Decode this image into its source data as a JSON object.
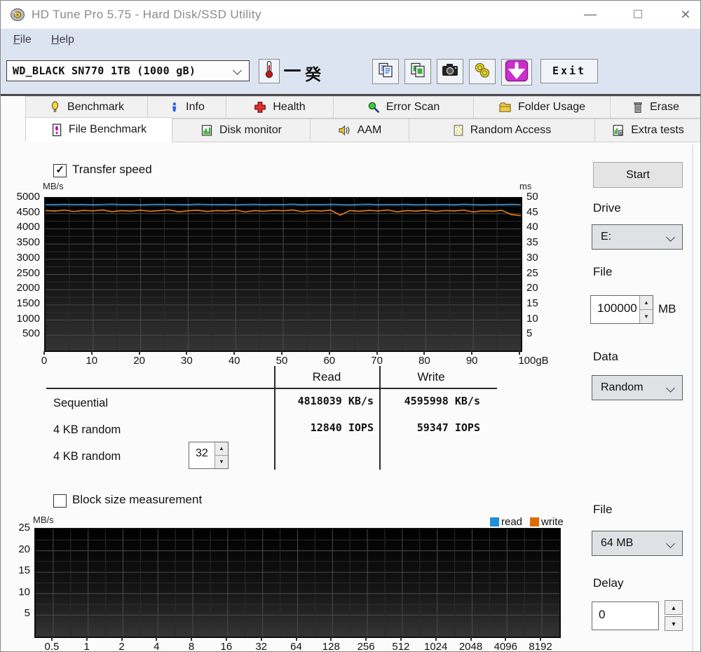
{
  "window": {
    "title": "HD Tune Pro 5.75 - Hard Disk/SSD Utility",
    "minimize": "—",
    "maximize": "□",
    "close": "×"
  },
  "menu": {
    "items": [
      {
        "label": "File"
      },
      {
        "label": "Help"
      }
    ]
  },
  "toolbar": {
    "device_selector": "WD_BLACK SN770 1TB (1000 gB)",
    "temperature_display": "癸",
    "exit_label": "Exit"
  },
  "tabs_row1": [
    {
      "id": "benchmark",
      "label": "Benchmark",
      "active": false
    },
    {
      "id": "info",
      "label": "Info",
      "active": false
    },
    {
      "id": "health",
      "label": "Health",
      "active": false
    },
    {
      "id": "error-scan",
      "label": "Error Scan",
      "active": false
    },
    {
      "id": "folder-usage",
      "label": "Folder Usage",
      "active": false
    },
    {
      "id": "erase",
      "label": "Erase",
      "active": false
    }
  ],
  "tabs_row2": [
    {
      "id": "file-benchmark",
      "label": "File Benchmark",
      "active": true
    },
    {
      "id": "disk-monitor",
      "label": "Disk monitor",
      "active": false
    },
    {
      "id": "aam",
      "label": "AAM",
      "active": false
    },
    {
      "id": "random-access",
      "label": "Random Access",
      "active": false
    },
    {
      "id": "extra-tests",
      "label": "Extra tests",
      "active": false
    }
  ],
  "panel": {
    "transfer_speed_label": "Transfer speed",
    "transfer_speed_checked": true,
    "block_size_label": "Block size measurement",
    "block_size_checked": false,
    "start_label": "Start",
    "drive_label": "Drive",
    "drive_value": "E:",
    "file_label": "File",
    "file_value": "100000",
    "file_unit": "MB",
    "data_label": "Data",
    "data_value": "Random",
    "file2_label": "File",
    "file2_value": "64 MB",
    "delay_label": "Delay",
    "delay_value": "0"
  },
  "table": {
    "headers": [
      "Read",
      "Write"
    ],
    "rows": [
      {
        "label": "Sequential",
        "read": "4818039 KB/s",
        "write": "4595998 KB/s"
      },
      {
        "label": "4 KB random",
        "read": "12840 IOPS",
        "write": "59347 IOPS"
      },
      {
        "label": "4 KB random",
        "read": "",
        "write": "",
        "queue_depth": "32"
      }
    ]
  },
  "legend": [
    {
      "label": "read",
      "color": "#1f8fd6"
    },
    {
      "label": "write",
      "color": "#e06a00"
    }
  ],
  "chart_data": [
    {
      "type": "line",
      "title": "Transfer speed",
      "ylabel_left": "MB/s",
      "ylabel_right": "ms",
      "ylim_left": [
        0,
        5000
      ],
      "ylim_right": [
        0,
        50
      ],
      "yticks_left": [
        5000,
        4500,
        4000,
        3500,
        3000,
        2500,
        2000,
        1500,
        1000,
        500
      ],
      "yticks_right": [
        50,
        45,
        40,
        35,
        30,
        25,
        20,
        15,
        10,
        5
      ],
      "x_ticks": [
        "0",
        "10",
        "20",
        "30",
        "40",
        "50",
        "60",
        "70",
        "80",
        "90",
        "100gB"
      ],
      "xlim": [
        0,
        100
      ],
      "grid": true,
      "series": [
        {
          "name": "read",
          "color": "#3f8fd0",
          "unit": "MB/s",
          "average": 4818,
          "values": [
            4800,
            4795,
            4805,
            4798,
            4802,
            4790,
            4800,
            4808,
            4795,
            4800,
            4785,
            4800,
            4803,
            4797,
            4800,
            4792,
            4806,
            4800,
            4795,
            4802,
            4788,
            4800,
            4805,
            4793,
            4800,
            4797,
            4808,
            4790,
            4800,
            4795,
            4803,
            4798,
            4785,
            4800,
            4806,
            4792,
            4800,
            4797,
            4805,
            4788,
            4800,
            4795,
            4802,
            4790,
            4807,
            4798,
            4785,
            4800,
            4795,
            4805,
            4798
          ]
        },
        {
          "name": "write",
          "color": "#e0761a",
          "unit": "MB/s",
          "average": 4596,
          "values": [
            4600,
            4585,
            4615,
            4570,
            4605,
            4590,
            4620,
            4565,
            4600,
            4582,
            4612,
            4575,
            4598,
            4625,
            4560,
            4595,
            4610,
            4572,
            4600,
            4588,
            4618,
            4555,
            4600,
            4578,
            4608,
            4592,
            4620,
            4565,
            4598,
            4585,
            4612,
            4450,
            4600,
            4575,
            4605,
            4590,
            4618,
            4560,
            4600,
            4582,
            4610,
            4570,
            4602,
            4588,
            4615,
            4555,
            4595,
            4580,
            4608,
            4470,
            4430
          ]
        }
      ]
    },
    {
      "type": "line",
      "title": "Block size measurement",
      "ylabel": "MB/s",
      "ylim": [
        0,
        25
      ],
      "yticks": [
        25,
        20,
        15,
        10,
        5
      ],
      "x_ticks": [
        "0.5",
        "1",
        "2",
        "4",
        "8",
        "16",
        "32",
        "64",
        "128",
        "256",
        "512",
        "1024",
        "2048",
        "4096",
        "8192"
      ],
      "grid": true,
      "series": [
        {
          "name": "read",
          "color": "#1f8fd6",
          "values": []
        },
        {
          "name": "write",
          "color": "#e06a00",
          "values": []
        }
      ]
    }
  ]
}
